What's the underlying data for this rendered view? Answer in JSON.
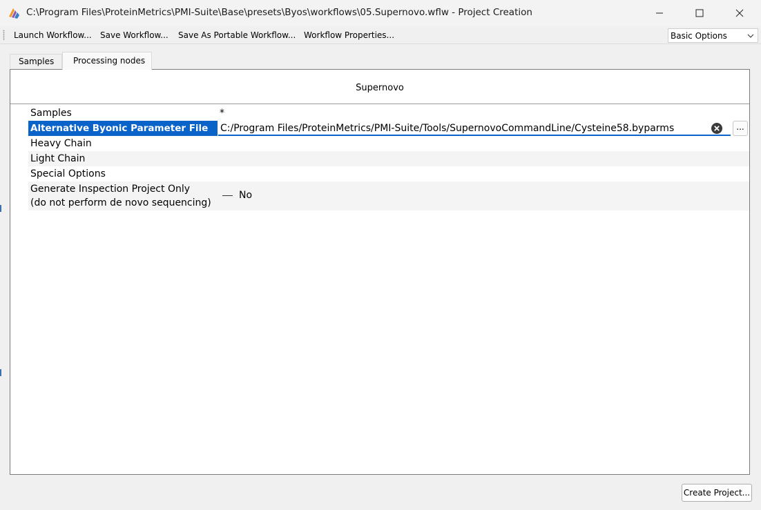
{
  "window": {
    "title": "C:\\Program Files\\ProteinMetrics\\PMI-Suite\\Base\\presets\\Byos\\workflows\\05.Supernovo.wflw - Project Creation",
    "icon": "pmi-app-icon"
  },
  "toolbar": {
    "items": [
      "Launch Workflow...",
      "Save Workflow...",
      "Save As Portable Workflow...",
      "Workflow Properties..."
    ],
    "options_combo": {
      "selected": "Basic Options"
    }
  },
  "tabs": [
    {
      "label": "Samples",
      "active": false
    },
    {
      "label": "Processing nodes",
      "active": true
    }
  ],
  "panel": {
    "title": "Supernovo",
    "rows": [
      {
        "label": "Samples",
        "value": "*"
      },
      {
        "label": "Alternative Byonic Parameter File",
        "value": "C:/Program Files/ProteinMetrics/PMI-Suite/Tools/SupernovoCommandLine/Cysteine58.byparms",
        "selected": true,
        "browse": "..."
      },
      {
        "label": "Heavy Chain",
        "value": ""
      },
      {
        "label": "Light Chain",
        "value": ""
      },
      {
        "label": "Special Options",
        "value": ""
      },
      {
        "label_line1": "Generate Inspection Project Only",
        "label_line2": "(do not perform de novo sequencing)",
        "value": "No"
      }
    ]
  },
  "footer": {
    "create_button": "Create Project..."
  },
  "colors": {
    "selection": "#0a63c9",
    "panel_bg": "#ffffff",
    "window_bg": "#f0f0f0"
  }
}
